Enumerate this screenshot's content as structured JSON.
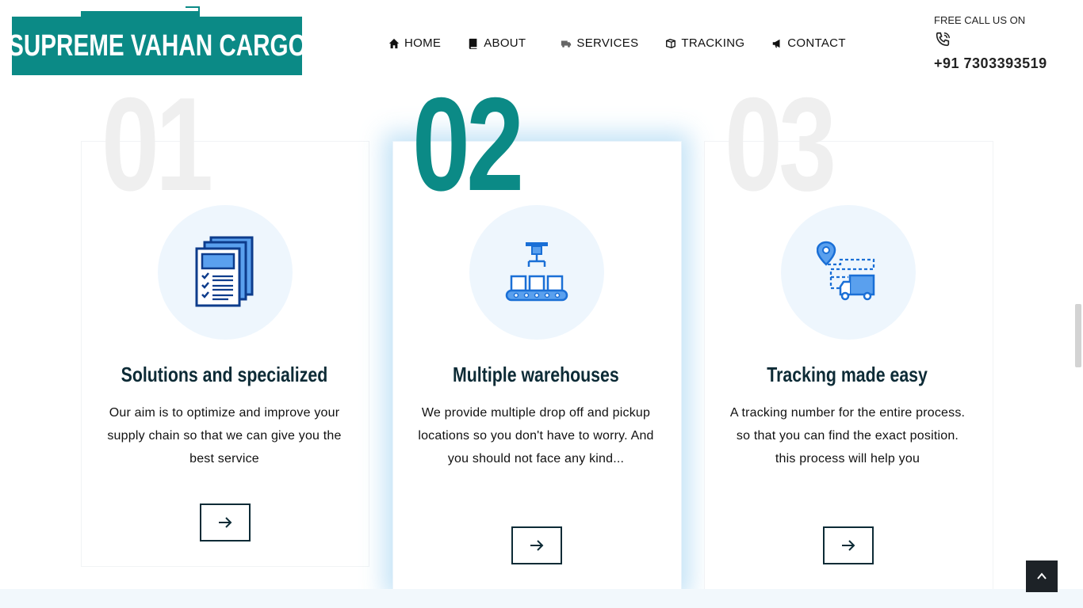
{
  "brand": {
    "name": "SUPREME VAHAN CARGO",
    "color": "#0b8a86"
  },
  "nav": [
    {
      "label": "HOME",
      "icon": "home-icon"
    },
    {
      "label": "ABOUT",
      "icon": "book-icon"
    },
    {
      "label": "SERVICES",
      "icon": "truck-icon"
    },
    {
      "label": "TRACKING",
      "icon": "box-icon"
    },
    {
      "label": "CONTACT",
      "icon": "megaphone-icon"
    }
  ],
  "call": {
    "label": "FREE CALL US ON",
    "number": "+91 7303393519",
    "icon": "phone-icon"
  },
  "cards": [
    {
      "number": "01",
      "title": "Solutions and specialized",
      "text": "Our aim is to optimize and improve your supply chain so that we can give you the best service",
      "icon": "documents-icon"
    },
    {
      "number": "02",
      "title": "Multiple warehouses",
      "text": "We provide multiple drop off and pickup locations so you don't have to worry. And you should not face any kind...",
      "icon": "conveyor-icon"
    },
    {
      "number": "03",
      "title": "Tracking made easy",
      "text": "A tracking number for the entire process. so that you can find the exact position. this process will help you",
      "icon": "tracking-route-icon"
    }
  ],
  "colors": {
    "accent": "#0b8a86",
    "icon_blue": "#1a6fd6",
    "heading": "#0d2b36"
  }
}
